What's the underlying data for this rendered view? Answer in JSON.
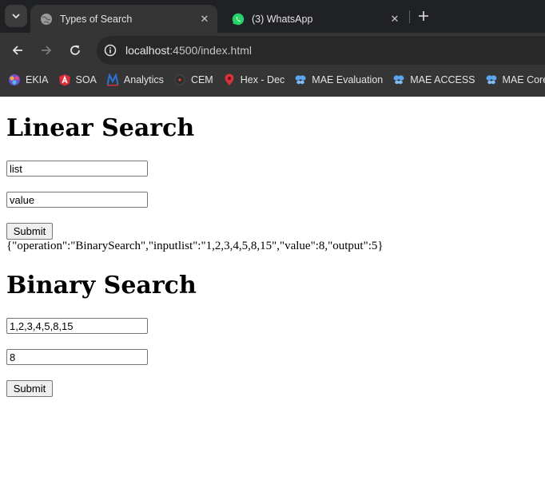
{
  "browser": {
    "tabs": [
      {
        "title": "Types of Search",
        "active": true,
        "favicon": "globe-icon"
      },
      {
        "title": "(3) WhatsApp",
        "active": false,
        "favicon": "whatsapp-icon"
      }
    ],
    "url_host": "localhost",
    "url_path": ":4500/index.html",
    "bookmarks": [
      {
        "label": "EKIA",
        "icon": "ekia-icon"
      },
      {
        "label": "SOA",
        "icon": "soa-icon"
      },
      {
        "label": "Analytics",
        "icon": "analytics-icon"
      },
      {
        "label": "CEM",
        "icon": "cem-icon"
      },
      {
        "label": "Hex - Dec",
        "icon": "map-pin-icon"
      },
      {
        "label": "MAE Evaluation",
        "icon": "butterfly-icon"
      },
      {
        "label": "MAE ACCESS",
        "icon": "butterfly-icon"
      },
      {
        "label": "MAE Core",
        "icon": "butterfly-icon"
      }
    ],
    "colors": {
      "tabstrip": "#202124",
      "toolbar": "#353535",
      "omnibox": "#282828"
    }
  },
  "linear": {
    "heading": "Linear Search",
    "list_value": "list",
    "value_value": "value",
    "submit_label": "Submit",
    "result": "{\"operation\":\"BinarySearch\",\"inputlist\":\"1,2,3,4,5,8,15\",\"value\":8,\"output\":5}"
  },
  "binary": {
    "heading": "Binary Search",
    "list_value": "1,2,3,4,5,8,15",
    "value_value": "8",
    "submit_label": "Submit"
  }
}
